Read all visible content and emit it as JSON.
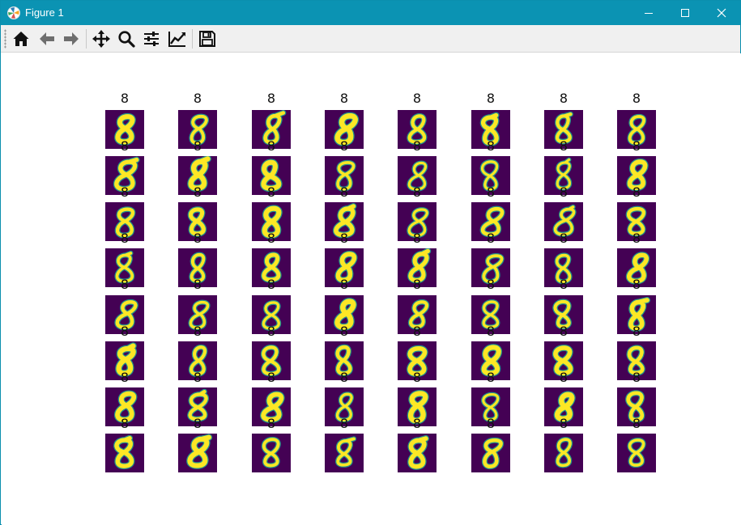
{
  "window": {
    "title": "Figure 1",
    "controls": {
      "minimize": "minimize-icon",
      "maximize": "maximize-icon",
      "close": "close-icon"
    },
    "accent": "#0b93b3"
  },
  "toolbar": {
    "buttons": [
      {
        "name": "home-button",
        "icon": "home-icon"
      },
      {
        "name": "back-button",
        "icon": "arrow-left-icon"
      },
      {
        "name": "forward-button",
        "icon": "arrow-right-icon"
      },
      {
        "name": "pan-button",
        "icon": "move-icon"
      },
      {
        "name": "zoom-button",
        "icon": "magnifier-icon"
      },
      {
        "name": "configure-subplots-button",
        "icon": "sliders-icon"
      },
      {
        "name": "edit-axes-button",
        "icon": "line-chart-icon"
      },
      {
        "name": "save-button",
        "icon": "floppy-disk-icon"
      }
    ]
  },
  "figure": {
    "rows": 8,
    "cols": 8,
    "top_titles": [
      "8",
      "8",
      "8",
      "8",
      "8",
      "8",
      "8",
      "8"
    ],
    "cell_label": "8",
    "colormap": {
      "background": "#440154",
      "mid": "#21918c",
      "high": "#fde725"
    },
    "digit_variants": [
      "loop",
      "upright",
      "slanted",
      "open-top",
      "cursive",
      "bold",
      "wide",
      "narrow"
    ]
  }
}
